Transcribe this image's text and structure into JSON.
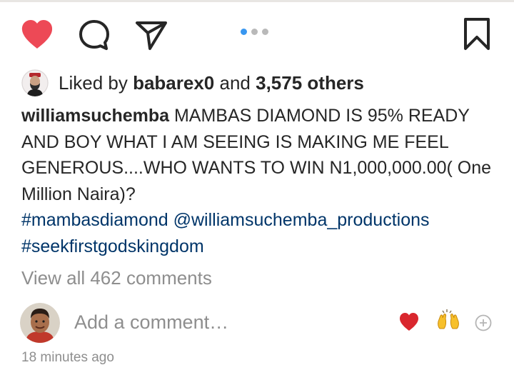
{
  "post": {
    "likes": {
      "prefix": "Liked by",
      "user": "babarex0",
      "middle": "and",
      "others": "3,575 others"
    },
    "caption": {
      "username": "williamsuchemba",
      "text": "MAMBAS DIAMOND IS 95% READY AND BOY WHAT I AM SEEING IS MAKING ME FEEL GENEROUS....WHO WANTS TO WIN N1,000,000.00( One Million Naira)?",
      "hashtag1": "#mambasdiamond",
      "mention": "@williamsuchemba_productions",
      "hashtag2": "#seekfirstgodskingdom"
    },
    "view_all_comments": "View all 462 comments",
    "comment_placeholder": "Add a comment…",
    "timestamp": "18 minutes ago"
  },
  "carousel": {
    "count": 3,
    "active_index": 0
  },
  "icons": {
    "like": "heart-filled-icon",
    "comment": "comment-bubble-icon",
    "share": "paper-plane-icon",
    "save": "bookmark-icon",
    "quick_reaction_1": "red-heart-emoji-icon",
    "quick_reaction_2": "raising-hands-emoji-icon",
    "more_reactions": "plus-circle-icon"
  },
  "colors": {
    "like_red": "#ed4956",
    "link_blue": "#003569",
    "muted_gray": "#8e8e8e",
    "active_dot": "#3897f0"
  }
}
